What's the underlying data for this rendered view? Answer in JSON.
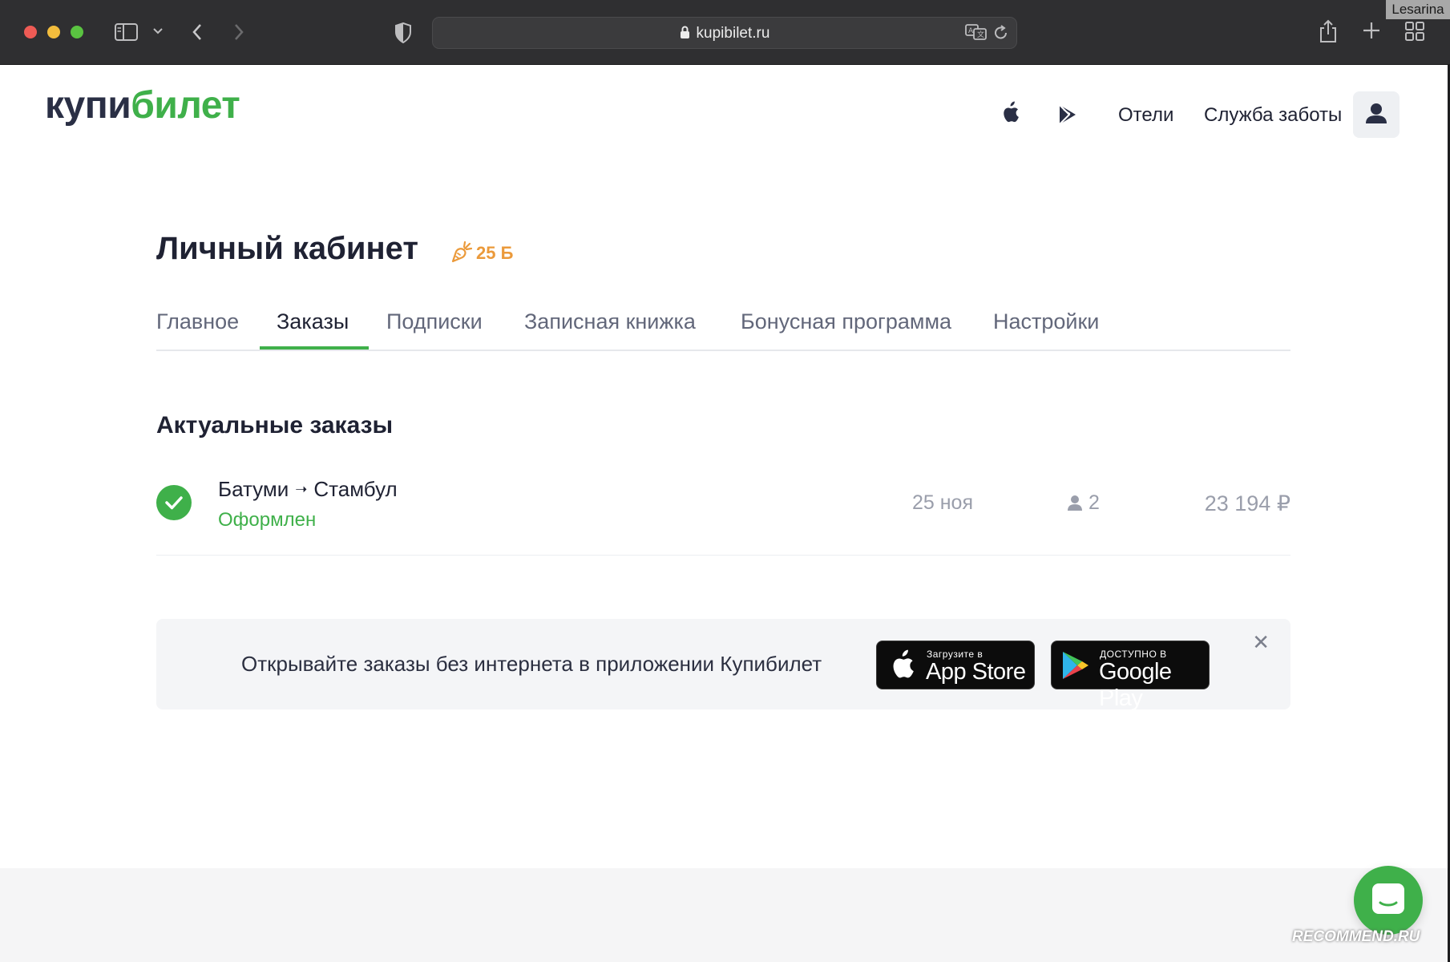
{
  "browser": {
    "url": "kupibilet.ru",
    "corner_watermark": "Lesarina"
  },
  "site": {
    "logo_part1": "купи",
    "logo_part2": "билет",
    "nav": {
      "hotels": "Отели",
      "support": "Служба заботы"
    }
  },
  "cabinet": {
    "title": "Личный кабинет",
    "bonus": "25 Б",
    "tabs": [
      {
        "label": "Главное"
      },
      {
        "label": "Заказы",
        "active": true
      },
      {
        "label": "Подписки"
      },
      {
        "label": "Записная книжка"
      },
      {
        "label": "Бонусная программа"
      },
      {
        "label": "Настройки"
      }
    ]
  },
  "orders": {
    "section_title": "Актуальные заказы",
    "items": [
      {
        "from": "Батуми",
        "arrow": "➝",
        "to": "Стамбул",
        "status": "Оформлен",
        "date": "25 ноя",
        "passengers": "2",
        "price": "23 194 ₽"
      }
    ]
  },
  "promo": {
    "text": "Открывайте заказы без интернета в приложении Купибилет",
    "appstore_small": "Загрузите в",
    "appstore_big": "App Store",
    "googleplay_small": "ДОСТУПНО В",
    "googleplay_big": "Google Play",
    "close": "✕"
  },
  "footer_watermark": "RECOMMEND.RU",
  "colors": {
    "accent": "#3fb04a",
    "bonus": "#eb9a3b",
    "text": "#1f2233",
    "muted": "#9a9eab"
  }
}
